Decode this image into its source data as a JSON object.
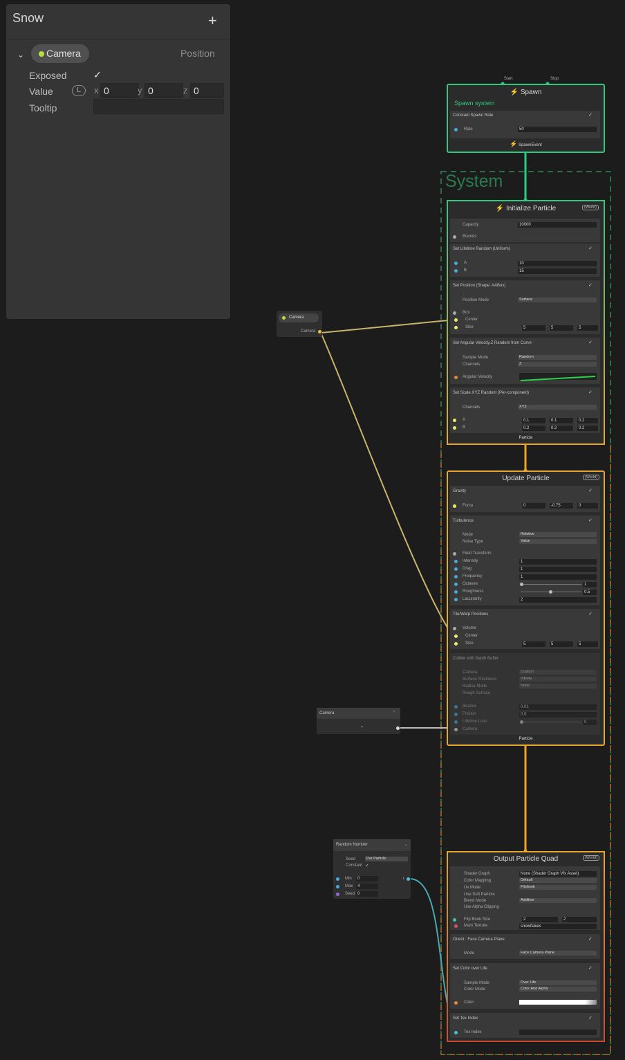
{
  "blackboard": {
    "title": "Snow",
    "add_symbol": "+",
    "property": {
      "name": "Camera",
      "type": "Position",
      "exposed_label": "Exposed",
      "exposed_checked": "✓",
      "value_label": "Value",
      "space_badge": "L",
      "x_label": "x",
      "x": "0",
      "y_label": "y",
      "y": "0",
      "z_label": "z",
      "z": "0",
      "tooltip_label": "Tooltip",
      "tooltip_value": ""
    }
  },
  "graph": {
    "spawn": {
      "start_label": "Start",
      "stop_label": "Stop",
      "title": "Spawn",
      "name": "Spawn system",
      "block_title": "Constant Spawn Rate",
      "rate_label": "Rate",
      "rate_value": "50",
      "event_label": "SpawnEvent"
    },
    "system_label": "System",
    "initialize": {
      "title": "Initialize Particle",
      "space_badge": "(World)",
      "capacity_label": "Capacity",
      "capacity_value": "10000",
      "bounds_label": "Bounds",
      "lifetime_title": "Set Lifetime Random (Uniform)",
      "lifetime_a_label": "A",
      "lifetime_a": "10",
      "lifetime_b_label": "B",
      "lifetime_b": "15",
      "position_title": "Set Position (Shape: AABox)",
      "position_mode_label": "Position Mode",
      "position_mode": "Surface",
      "box_label": "Box",
      "center_label": "Center",
      "size_label": "Size",
      "size_x": "5",
      "size_y": "5",
      "size_z": "5",
      "angular_title": "Set Angular Velocity.Z Random from Curve",
      "sample_mode_label": "Sample Mode",
      "sample_mode": "Random",
      "channels_label": "Channels",
      "channels": "Z",
      "angular_velocity_label": "Angular Velocity",
      "scale_title": "Set Scale.XYZ Random (Per-component)",
      "scale_channels_label": "Channels",
      "scale_channels": "XYZ",
      "scale_a_label": "A",
      "scale_a": [
        "0.1",
        "0.1",
        "0.2"
      ],
      "scale_b_label": "B",
      "scale_b": [
        "0.2",
        "0.2",
        "0.2"
      ],
      "out_label": "Particle"
    },
    "update": {
      "title": "Update Particle",
      "space_badge": "(World)",
      "gravity_title": "Gravity",
      "force_label": "Force",
      "force": [
        "0",
        "-0.75",
        "0"
      ],
      "turbulence_title": "Turbulence",
      "mode_label": "Mode",
      "mode": "Relative",
      "noise_type_label": "Noise Type",
      "noise_type": "Value",
      "field_transform_label": "Field Transform",
      "intensity_label": "Intensity",
      "intensity": "1",
      "drag_label": "Drag",
      "drag": "1",
      "frequency_label": "Frequency",
      "frequency": "1",
      "octaves_label": "Octaves",
      "octaves": "1",
      "roughness_label": "Roughness",
      "roughness": "0.5",
      "lacunarity_label": "Lacunarity",
      "lacunarity": "2",
      "tile_title": "Tile/Warp Positions",
      "volume_label": "Volume",
      "center_label": "Center",
      "size_label": "Size",
      "size": [
        "5",
        "5",
        "5"
      ],
      "collide_title": "Collide with Depth Buffer",
      "camera_label": "Camera",
      "camera": "Custom",
      "surface_thickness_label": "Surface Thickness",
      "surface_thickness": "Infinite",
      "radius_mode_label": "Radius Mode",
      "radius_mode": "None",
      "rough_surface_label": "Rough Surface",
      "bounce_label": "Bounce",
      "bounce": "0.01",
      "friction_label": "Friction",
      "friction": "0.5",
      "lifetime_loss_label": "Lifetime Loss",
      "lifetime_loss": "0",
      "camera_port_label": "Camera",
      "out_label": "Particle"
    },
    "output": {
      "title": "Output Particle Quad",
      "space_badge": "(World)",
      "shader_graph_label": "Shader Graph",
      "shader_graph": "None (Shader Graph Vfx Asset)",
      "color_mapping_label": "Color Mapping",
      "color_mapping": "Default",
      "uv_mode_label": "Uv Mode",
      "uv_mode": "Flipbook",
      "use_soft_particle_label": "Use Soft Particle",
      "blend_mode_label": "Blend Mode",
      "blend_mode": "Additive",
      "use_alpha_clipping_label": "Use Alpha Clipping",
      "flipbook_size_label": "Flip Book Size",
      "flipbook_x": "2",
      "flipbook_y": "2",
      "main_texture_label": "Main Texture",
      "main_texture": "snowflakes",
      "orient_title": "Orient : Face Camera Plane",
      "orient_mode_label": "Mode",
      "orient_mode": "Face Camera Plane",
      "color_life_title": "Set Color over Life",
      "color_sample_mode_label": "Sample Mode",
      "color_sample_mode": "Over Life",
      "color_mode_label": "Color Mode",
      "color_mode": "Color And Alpha",
      "color_label": "Color",
      "tex_index_title": "Set Tex Index",
      "tex_index_label": "Tex Index"
    },
    "camera_param_node": {
      "title": "Camera",
      "out_label": "Camera"
    },
    "camera_op_node": {
      "title": "Camera"
    },
    "random_node": {
      "title": "Random Number",
      "seed_label": "Seed",
      "seed": "Per Particle",
      "constant_label": "Constant",
      "constant_checked": "✓",
      "min_label": "Min",
      "min": "0",
      "max_label": "Max",
      "max": "4",
      "seed_in_label": "Seed",
      "seed_in": "0",
      "out_label": "r"
    }
  },
  "colors": {
    "spawn_border": "#2fc97f",
    "init_border": "#e9a62d",
    "output_border": "#d0542e",
    "system_border": "#2b6b4a",
    "camera_wire": "#c8b46a",
    "random_wire": "#4aa8b0"
  }
}
